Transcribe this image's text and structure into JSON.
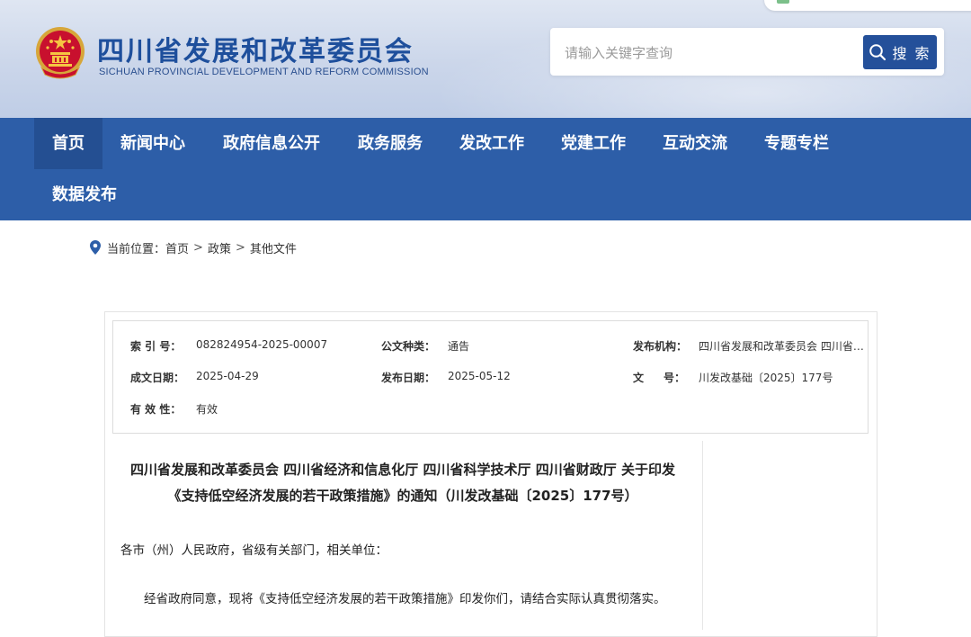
{
  "site": {
    "name_cn": "四川省发展和改革委员会",
    "name_en": "SICHUAN PROVINCIAL DEVELOPMENT AND REFORM COMMISSION"
  },
  "search": {
    "placeholder": "请输入关键字查询",
    "button_label": "搜 索"
  },
  "nav": {
    "items": [
      {
        "label": "首页",
        "active": true
      },
      {
        "label": "新闻中心"
      },
      {
        "label": "政府信息公开"
      },
      {
        "label": "政务服务"
      },
      {
        "label": "发改工作"
      },
      {
        "label": "党建工作"
      },
      {
        "label": "互动交流"
      },
      {
        "label": "专题专栏"
      },
      {
        "label": "数据发布"
      }
    ]
  },
  "breadcrumb": {
    "prefix": "当前位置：",
    "items": [
      "首页",
      "政策",
      "其他文件"
    ],
    "separator": ">"
  },
  "meta": {
    "index_label": "索 引 号：",
    "index_value": "082824954-2025-00007",
    "type_label": "公文种类：",
    "type_value": "通告",
    "publisher_label": "发布机构：",
    "publisher_value": "四川省发展和改革委员会 四川省…",
    "created_label": "成文日期：",
    "created_value": "2025-04-29",
    "published_label": "发布日期：",
    "published_value": "2025-05-12",
    "docno_label_a": "文",
    "docno_label_b": "号：",
    "docno_value": "川发改基础〔2025〕177号",
    "validity_label": "有 效 性：",
    "validity_value": "有效"
  },
  "document": {
    "title_line1": "四川省发展和改革委员会 四川省经济和信息化厅 四川省科学技术厅 四川省财政厅 关于印发",
    "title_line2": "《支持低空经济发展的若干政策措施》的通知（川发改基础〔2025〕177号）",
    "salutation": "各市（州）人民政府，省级有关部门，相关单位：",
    "paragraph1": "经省政府同意，现将《支持低空经济发展的若干政策措施》印发你们，请结合实际认真贯彻落实。"
  },
  "colors": {
    "brand_blue": "#2d5ea8",
    "nav_active": "#244f92",
    "search_button": "#24509a"
  }
}
